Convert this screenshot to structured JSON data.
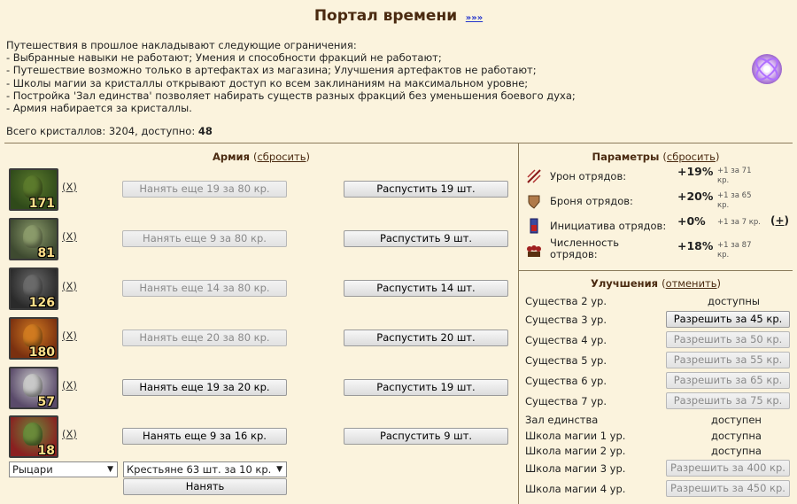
{
  "header": {
    "title": "Портал времени",
    "link": "»»»"
  },
  "intro": {
    "lines": [
      "Путешествия в прошлое накладывают следующие ограничения:",
      "- Выбранные навыки не работают; Умения и способности фракций не работают;",
      "- Путешествие возможно только в артефактах из магазина; Улучшения артефактов не работают;",
      "- Школы магии за кристаллы открывают доступ ко всем заклинаниям на максимальном уровне;",
      "- Постройка 'Зал единства' позволяет набирать существ разных фракций без уменьшения боевого духа;",
      "- Армия набирается за кристаллы."
    ],
    "crystals_prefix": "Всего кристаллов: 3204, доступно:",
    "crystals_available": "48"
  },
  "army": {
    "title": "Армия",
    "reset": "сбросить",
    "units": [
      {
        "count": "171",
        "remove": "X",
        "hire": "Нанять еще 19 за 80 кр.",
        "hire_enabled": false,
        "dismiss": "Распустить 19 шт.",
        "colors": [
          "#5b7a2c",
          "#2f4a1a"
        ]
      },
      {
        "count": "81",
        "remove": "X",
        "hire": "Нанять еще 9 за 80 кр.",
        "hire_enabled": false,
        "dismiss": "Распустить 9 шт.",
        "colors": [
          "#8a9a6a",
          "#3e4a30"
        ]
      },
      {
        "count": "126",
        "remove": "X",
        "hire": "Нанять еще 14 за 80 кр.",
        "hire_enabled": false,
        "dismiss": "Распустить 14 шт.",
        "colors": [
          "#6a6a6a",
          "#2a2a2a"
        ]
      },
      {
        "count": "180",
        "remove": "X",
        "hire": "Нанять еще 20 за 80 кр.",
        "hire_enabled": false,
        "dismiss": "Распустить 20 шт.",
        "colors": [
          "#d07a20",
          "#7a3010"
        ]
      },
      {
        "count": "57",
        "remove": "X",
        "hire": "Нанять еще 19 за 20 кр.",
        "hire_enabled": true,
        "dismiss": "Распустить 19 шт.",
        "colors": [
          "#c8c8c8",
          "#5a4a6a"
        ]
      },
      {
        "count": "18",
        "remove": "X",
        "hire": "Нанять еще 9 за 16 кр.",
        "hire_enabled": true,
        "dismiss": "Распустить 9 шт.",
        "colors": [
          "#6a8a3a",
          "#8a2020"
        ]
      }
    ],
    "faction_select": "Рыцари",
    "unit_select": "Крестьяне 63 шт. за 10 кр.",
    "hire_button": "Нанять"
  },
  "params": {
    "title": "Параметры",
    "reset": "сбросить",
    "rows": [
      {
        "icon": "damage-icon",
        "label": "Урон отрядов:",
        "value": "+19%",
        "note": "+1 за 71 кр."
      },
      {
        "icon": "armor-icon",
        "label": "Броня отрядов:",
        "value": "+20%",
        "note": "+1 за 65 кр."
      },
      {
        "icon": "initiative-icon",
        "label": "Инициатива отрядов:",
        "value": "+0%",
        "note": "+1 за 7 кр.",
        "action": "+"
      },
      {
        "icon": "numbers-icon",
        "label": "Численность отрядов:",
        "value": "+18%",
        "note": "+1 за 87 кр."
      }
    ]
  },
  "upgrades": {
    "title": "Улучшения",
    "cancel": "отменить",
    "rows": [
      {
        "label": "Существа 2 ур.",
        "status": "доступны"
      },
      {
        "label": "Существа 3 ур.",
        "button": "Разрешить за 45 кр.",
        "enabled": true
      },
      {
        "label": "Существа 4 ур.",
        "button": "Разрешить за 50 кр.",
        "enabled": false
      },
      {
        "label": "Существа 5 ур.",
        "button": "Разрешить за 55 кр.",
        "enabled": false
      },
      {
        "label": "Существа 6 ур.",
        "button": "Разрешить за 65 кр.",
        "enabled": false
      },
      {
        "label": "Существа 7 ур.",
        "button": "Разрешить за 75 кр.",
        "enabled": false
      },
      {
        "label": "Зал единства",
        "status": "доступен"
      },
      {
        "label": "Школа магии 1 ур.",
        "status": "доступна"
      },
      {
        "label": "Школа магии 2 ур.",
        "status": "доступна"
      },
      {
        "label": "Школа магии 3 ур.",
        "button": "Разрешить за 400 кр.",
        "enabled": false
      },
      {
        "label": "Школа магии 4 ур.",
        "button": "Разрешить за 450 кр.",
        "enabled": false
      }
    ]
  },
  "colors": {
    "background": "#fbf3dd",
    "title": "#4a2a10",
    "link": "#2233cc"
  }
}
